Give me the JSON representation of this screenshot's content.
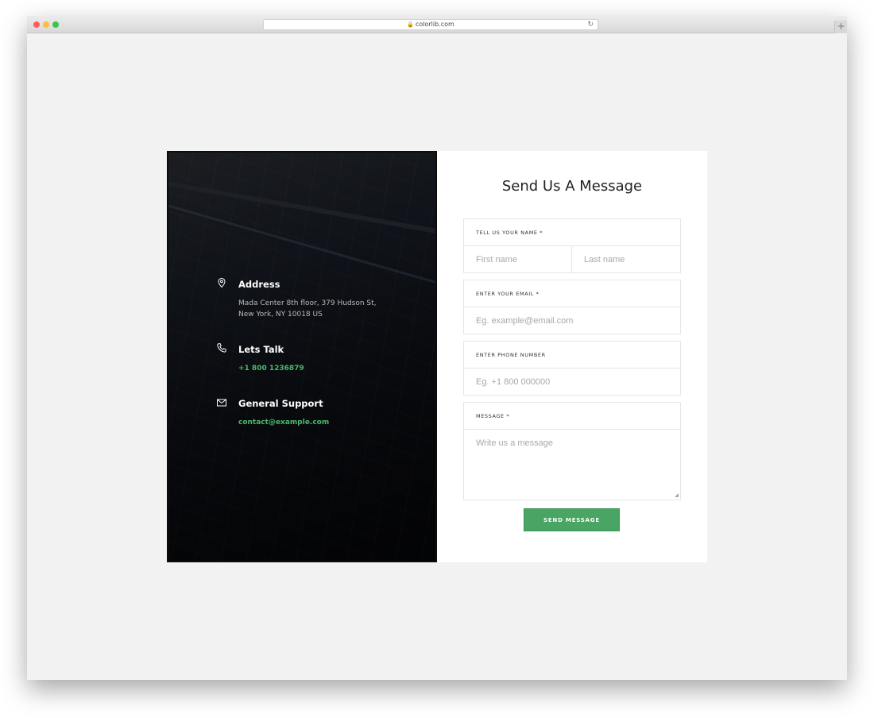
{
  "browser": {
    "url": "colorlib.com"
  },
  "contact": {
    "address": {
      "title": "Address",
      "line1": "Mada Center 8th floor, 379 Hudson St,",
      "line2": "New York, NY 10018 US",
      "icon": "location-pin-icon"
    },
    "talk": {
      "title": "Lets Talk",
      "phone": "+1 800 1236879",
      "icon": "phone-icon"
    },
    "support": {
      "title": "General Support",
      "email": "contact@example.com",
      "icon": "mail-icon"
    },
    "accent_color": "#4cb96b"
  },
  "form": {
    "title": "Send Us A Message",
    "name": {
      "label": "TELL US YOUR NAME *",
      "first_placeholder": "First name",
      "last_placeholder": "Last name"
    },
    "email": {
      "label": "ENTER YOUR EMAIL *",
      "placeholder": "Eg. example@email.com"
    },
    "phone": {
      "label": "ENTER PHONE NUMBER",
      "placeholder": "Eg. +1 800 000000"
    },
    "message": {
      "label": "MESSAGE *",
      "placeholder": "Write us a message"
    },
    "submit_label": "SEND MESSAGE",
    "button_color": "#4aa564"
  }
}
